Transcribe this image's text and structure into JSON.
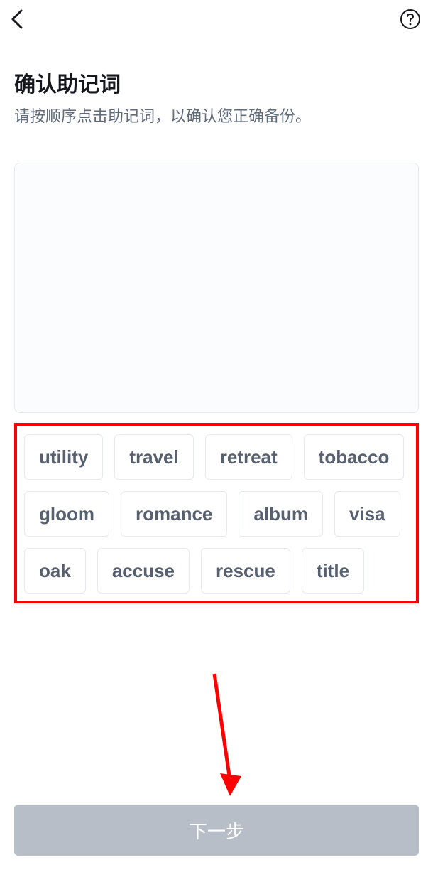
{
  "header": {
    "back_icon": "chevron-left",
    "help_icon": "question-circle"
  },
  "title": "确认助记词",
  "subtitle": "请按顺序点击助记词，以确认您正确备份。",
  "mnemonic_words": [
    "utility",
    "travel",
    "retreat",
    "tobacco",
    "gloom",
    "romance",
    "album",
    "visa",
    "oak",
    "accuse",
    "rescue",
    "title"
  ],
  "next_button_label": "下一步",
  "annotations": {
    "highlight_color": "#ff0000",
    "arrow_color": "#ff0000"
  }
}
